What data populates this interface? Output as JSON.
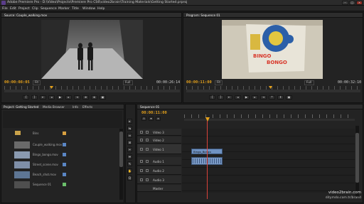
{
  "window": {
    "title": "Adobe Premiere Pro - D:\\Video\\Projects\\Premiere Pro CS6\\video2brain\\Training Materials\\Getting Started.prproj"
  },
  "menu": [
    "File",
    "Edit",
    "Project",
    "Clip",
    "Sequence",
    "Marker",
    "Title",
    "Window",
    "Help"
  ],
  "source_monitor": {
    "tab": "Source: Couple_walking.mov",
    "timecode_left": "00:00:08:05",
    "fit": "Fit",
    "timecode_right": "00:00:26:14",
    "res": "Full"
  },
  "program_monitor": {
    "tab": "Program: Sequence 01",
    "timecode_left": "00:00:11:00",
    "fit": "Fit",
    "timecode_right": "00:00:32:10",
    "res": "Full",
    "sign_text_1": "BINGO",
    "sign_text_2": "BONGO"
  },
  "project_panel": {
    "tabs": [
      "Project: Getting Started",
      "Media Browser",
      "Info",
      "Effects"
    ],
    "items": [
      {
        "name": "Bins"
      },
      {
        "name": "Couple_walking.mov"
      },
      {
        "name": "Bingo_bongo.mov"
      },
      {
        "name": "Street_scene.mov"
      },
      {
        "name": "Beach_shot.mov"
      },
      {
        "name": "Sequence 01"
      }
    ]
  },
  "timeline": {
    "tab": "Sequence 01",
    "timecode": "00:00:11:00",
    "video_tracks": [
      "Video 3",
      "Video 2",
      "Video 1"
    ],
    "audio_tracks": [
      "Audio 1",
      "Audio 2",
      "Audio 3"
    ],
    "master": "Master",
    "clip_name": "Bingo_Bongo"
  },
  "tools": [
    "▸",
    "⇆",
    "⇔",
    "⊞",
    "✂",
    "⇹",
    "✎",
    "✋",
    "Q"
  ],
  "watermark": {
    "line1": "video2brain.com",
    "line2": "ditymdo.com.tr/brand"
  }
}
